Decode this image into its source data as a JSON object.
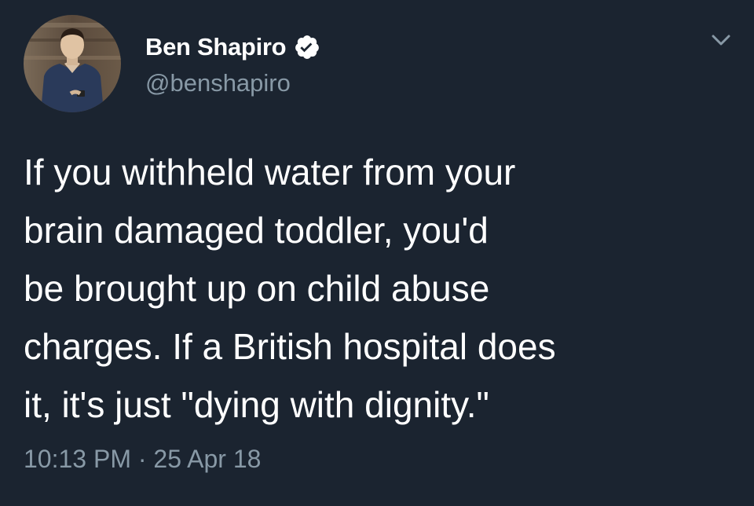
{
  "tweet": {
    "author": {
      "display_name": "Ben Shapiro",
      "handle": "@benshapiro",
      "verified": true,
      "avatar_icon": "profile-photo"
    },
    "body_lines": [
      "If you withheld water from your",
      "brain damaged toddler, you'd",
      "be brought up on child abuse",
      "charges. If a British hospital does",
      "it, it's just \"dying with dignity.\""
    ],
    "time": "10:13 PM",
    "separator": "·",
    "date": "25 Apr 18",
    "menu_icon": "chevron-down-icon"
  },
  "colors": {
    "background": "#1b2430",
    "text_primary": "#ffffff",
    "text_secondary": "#8899a6",
    "verified_badge": "#ffffff"
  }
}
